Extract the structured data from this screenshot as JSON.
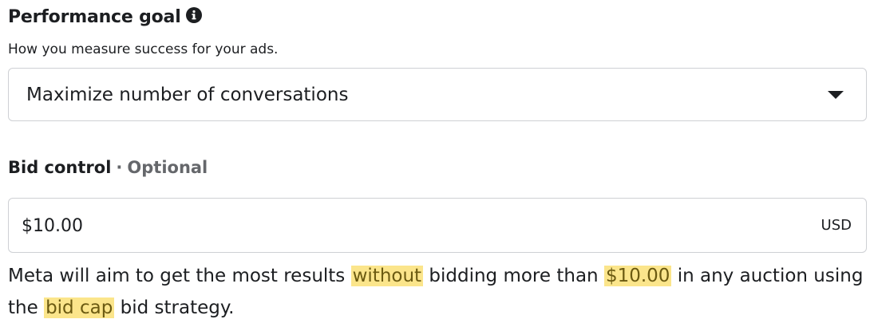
{
  "performance_goal": {
    "title": "Performance goal",
    "info_icon": "info-circle-icon",
    "subtitle": "How you measure success for your ads.",
    "selected": "Maximize number of conversations",
    "dropdown_icon": "caret-down-icon"
  },
  "bid_control": {
    "label": "Bid control",
    "separator": "·",
    "optional": "Optional",
    "value": "$10.00",
    "currency": "USD"
  },
  "help": {
    "part1": "Meta will aim to get the most results ",
    "hl1": "without",
    "part2": " bidding more than ",
    "hl2": "$10.00",
    "part3": " in any auction using the ",
    "hl3": "bid cap",
    "part4": " bid strategy."
  },
  "colors": {
    "highlight": "#fbe58b",
    "border": "#ced0d4",
    "text": "#1c1e21",
    "muted": "#65676b"
  }
}
